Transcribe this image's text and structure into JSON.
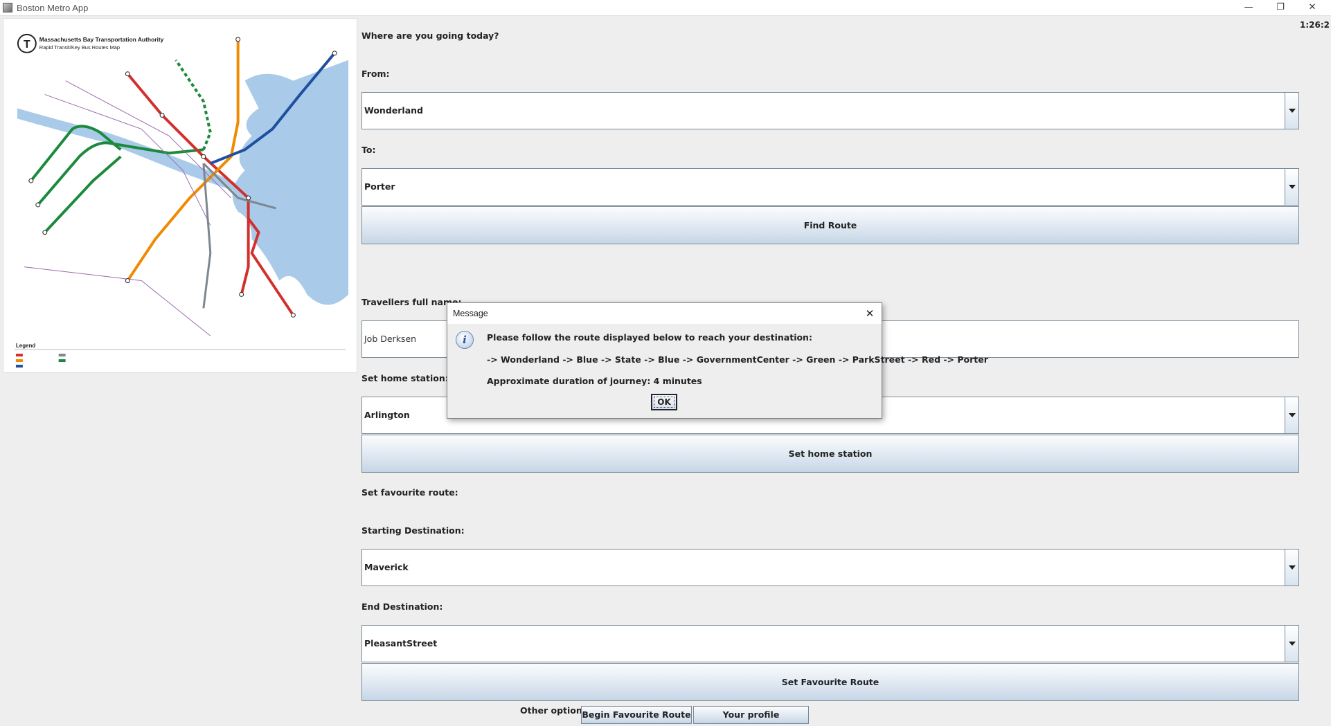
{
  "window": {
    "title": "Boston Metro App",
    "minimize": "—",
    "maximize": "❐",
    "close": "✕"
  },
  "clock": "1:26:2",
  "map": {
    "authority": "Massachusetts Bay Transportation Authority",
    "subtitle": "Rapid Transit/Key Bus Routes Map",
    "legend": "Legend",
    "colors": {
      "red_line": "#d2302c",
      "orange_line": "#f08a00",
      "blue_line": "#1f4f9e",
      "green_line": "#1c8a3c",
      "silver_line": "#7c878e",
      "water": "#a9cbe9"
    }
  },
  "form": {
    "prompt": "Where are you going today?",
    "from_label": "From:",
    "from_value": "Wonderland",
    "to_label": "To:",
    "to_value": "Porter",
    "find_route": "Find Route",
    "name_label": "Travellers full name:",
    "name_value": "Job Derksen",
    "home_label": "Set home station:",
    "home_value": "Arlington",
    "set_home": "Set home station",
    "fav_label": "Set favourite route:",
    "start_label": "Starting Destination:",
    "start_value": "Maverick",
    "end_label": "End Destination:",
    "end_value": "PleasantStreet",
    "set_fav": "Set Favourite Route",
    "other_label": "Other options:",
    "begin_fav": "Begin Favourite Route",
    "profile": "Your profile information"
  },
  "dialog": {
    "title": "Message",
    "close": "✕",
    "line1": "Please follow the route displayed below to reach your destination:",
    "line2": "-> Wonderland -> Blue -> State -> Blue -> GovernmentCenter -> Green -> ParkStreet -> Red -> Porter",
    "line3": "Approximate duration of journey: 4 minutes",
    "ok": "OK"
  }
}
